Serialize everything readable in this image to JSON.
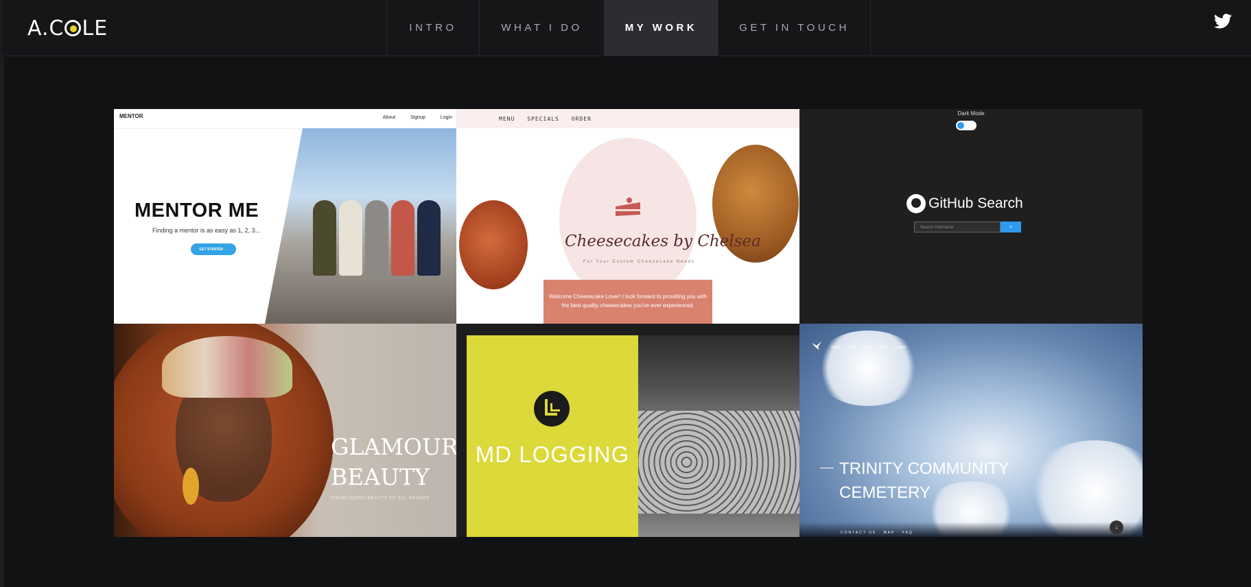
{
  "header": {
    "logo_text": "A.C",
    "logo_text_end": "LE",
    "nav": [
      {
        "label": "INTRO"
      },
      {
        "label": "WHAT I DO"
      },
      {
        "label": "MY WORK",
        "active": true
      },
      {
        "label": "GET IN TOUCH"
      }
    ],
    "twitter_icon": "twitter-icon"
  },
  "projects": {
    "mentor": {
      "brand": "MENTOR",
      "links": [
        "About",
        "Signup",
        "Login"
      ],
      "title": "MENTOR ME",
      "subtitle": "Finding a mentor is as easy as 1, 2, 3...",
      "button": "GET STARTED →"
    },
    "cheesecake": {
      "menu": [
        "MENU",
        "SPECIALS",
        "ORDER"
      ],
      "title": "Cheesecakes by Chelsea",
      "tagline": "For Your Custom Cheesecake Needs",
      "welcome_line1": "Welcome Cheesecake Lover! I look forward to providing you with",
      "welcome_line2": "the best quality cheesecakes you've ever experienced."
    },
    "github": {
      "dark_mode_label": "Dark Mode",
      "title": "GitHub Search",
      "search_placeholder": "Search Username"
    },
    "glamour": {
      "title_line1": "GLAMOUR",
      "title_line2": "BEAUTY",
      "subtitle": "SHOWCASING BEAUTY OF ALL SHADES"
    },
    "logging": {
      "title": "MD LOGGING"
    },
    "trinity": {
      "nav": [
        "Home",
        "About",
        "Rates",
        "News",
        "Contact"
      ],
      "title_line1": "TRINITY COMMUNITY",
      "title_line2": "CEMETERY",
      "footer": "CONTACT US · MAP · FAQ"
    }
  },
  "colors": {
    "background": "#111214",
    "accent_yellow": "#e8d526",
    "active_nav_bg": "#2c2d30"
  }
}
